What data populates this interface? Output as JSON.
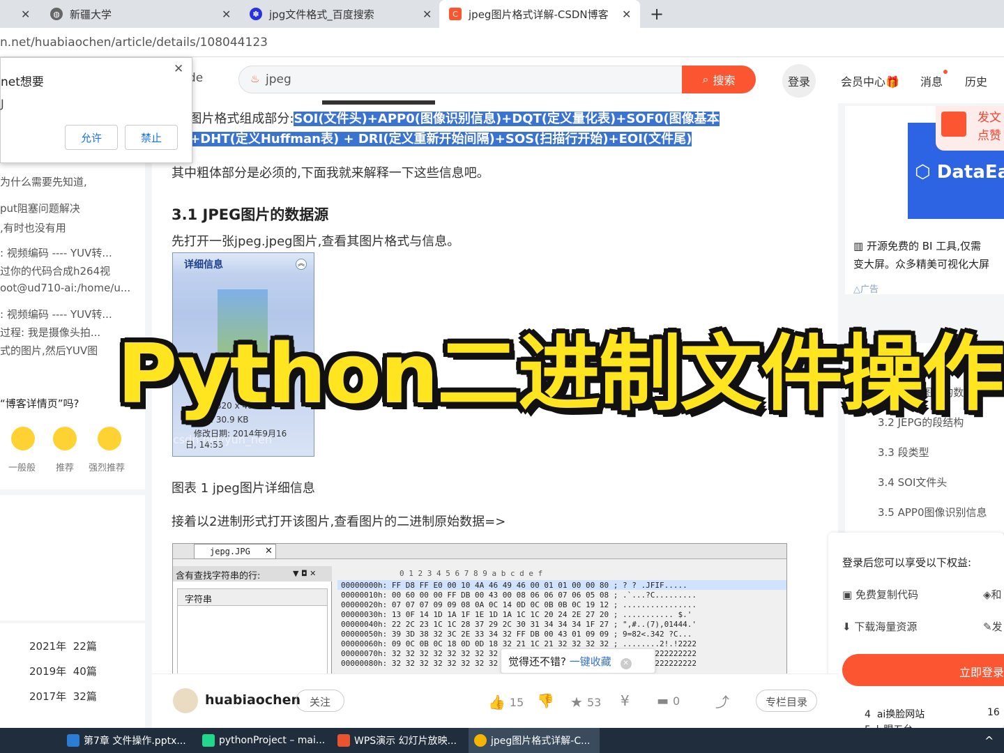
{
  "browser": {
    "tabs": [
      {
        "label": "新疆大学",
        "close": "✕"
      },
      {
        "label": "jpg文件格式_百度搜索",
        "close": "✕"
      },
      {
        "label": "jpeg图片格式详解-CSDN博客",
        "close": "✕"
      }
    ],
    "first_close": "✕",
    "new_tab": "+",
    "url": "n.net/huabiaochen/article/details/108044123"
  },
  "permission_popup": {
    "title": "net想要",
    "line2": "J",
    "allow": "允许",
    "deny": "禁止",
    "close": "✕"
  },
  "nav": {
    "left_fragment": "de",
    "search_value": "jpeg",
    "search_button": "搜索",
    "login": "登录",
    "member": "会员中心",
    "messages": "消息",
    "history": "历史"
  },
  "left": {
    "items": [
      "为什么需要先知道,",
      "put阻塞问题解决",
      ",有时也没有用",
      ":  视频编码 ---- YUV转...",
      "过你的代码合成h264视",
      "oot@ud710-ai:/home/u...",
      ":  视频编码 ---- YUV转...",
      "过程:  我是摄像头拍...",
      "式的图片,然后YUV图"
    ],
    "survey_title": "“博客详情页”吗?",
    "ratings": [
      "一般般",
      "推荐",
      "强烈推荐"
    ],
    "archive": [
      {
        "year": "2021年",
        "count": "22篇"
      },
      {
        "year": "2019年",
        "count": "40篇"
      },
      {
        "year": "2017年",
        "count": "32篇"
      }
    ]
  },
  "article": {
    "intro_prefix": "EG图片格式组成部分:",
    "intro_hl1": "SOI(文件头)+APP0(图像识别信息)+DQT(定义量化表)+SOF0(图像基本",
    "intro_hl2": "息)+DHT(定义Huffman表) + DRI(定义重新开始间隔)+SOS(扫描行开始)+EOI(文件尾)",
    "note": "其中粗体部分是必须的,下面我就来解释一下这些信息吧。",
    "h3": "3.1 JPEG图片的数据源",
    "p1": "先打开一张jpeg.jpeg图片,查看其图片格式与信息。",
    "detail_title": "详细信息",
    "detail_type": "图像",
    "detail_size": "尺寸: 320 x 480",
    "detail_filesize": "大小: 30.9 KB",
    "detail_date": "修改日期: 2014年9月16",
    "detail_time": "日, 14:53",
    "watermark": "csdn.net/yun_hen",
    "caption": "图表 1 jpeg图片详细信息",
    "p2": "接着以2进制形式打开该图片,查看图片的二进制原始数据=>",
    "hex_tab": "jepg.JPG",
    "hex_panel_label": "含有查找字符串的行:",
    "hex_column": "字符串",
    "hex_header": "0  1  2  3  4  5  6  7  8  9  a  b  c  d  e  f",
    "hex_rows": [
      "00000000h: FF D8 FF E0 00 10 4A 46 49 46 00 01 01 00 00 80 ; ?  ? .JFIF.....",
      "00000010h: 00 60 00 00 FF DB 00 43 00 08 06 06 07 06 05 08 ; .`...?C.........",
      "00000020h: 07 07 07 09 09 08 0A 0C 14 0D 0C 0B 0B 0C 19 12 ; ................",
      "00000030h: 13 0F 14 1D 1A 1F 1E 1D 1A 1C 1C 20 24 2E 27 20 ; ........... $.' ",
      "00000040h: 22 2C 23 1C 1C 28 37 29 2C 30 31 34 34 34 1F 27 ; \",#..(7),01444.'",
      "00000050h: 39 3D 38 32 3C 2E 33 34 32 FF DB 00 43 01 09 09 ; 9=82<.342 ?C...",
      "00000060h: 09 0C 0B 0C 18 0D 0D 18 32 21 1C 21 32 32 32 32 ; ........2!.!2222",
      "00000070h: 32 32 32 32 32 32 32 32 32 32 32 32 32 32 32 32 ; 2222222222222222",
      "00000080h: 32 32 32 32 32 32 32 32 32 32 32 32 32 32 32 32 ; 2222222222222222"
    ],
    "tip": "觉得还不错?",
    "tip_action": "一键收藏"
  },
  "overlay_title": "Python二进制文件操作",
  "author_bar": {
    "name": "huabiaochen",
    "follow": "关注",
    "likes": "15",
    "stars": "53",
    "comments": "0",
    "catalog": "专栏目录"
  },
  "sidebar": {
    "ad_brand": "DataEa",
    "ad_badge1": "发文",
    "ad_badge2": "点赞",
    "ad_text1": "开源免费的 BI 工具,仅需",
    "ad_text2": "变大屏。众多精美可视化大屏",
    "ad_label": "广告",
    "toc_title": "G图片格式详解",
    "toc": [
      "3.1 JPEG图片的数据源",
      "3.2 JEPG的段结构",
      "3.3 段类型",
      "3.4 SOI文件头",
      "3.5 APP0图像识别信息"
    ],
    "login_title": "登录后您可以享受以下权益:",
    "benefits": [
      "免费复制代码",
      "下载海量资源"
    ],
    "benefit_r1": "和",
    "benefit_r2": "发",
    "login_button": "立即登录",
    "rank_item": "ai换脸网站",
    "rank_num": "4",
    "rank_count": "16",
    "rank_next": "5  ト眼五台"
  },
  "taskbar": {
    "items": [
      "第7章 文件操作.pptx...",
      "pythonProject – mai...",
      "WPS演示 幻灯片放映...",
      "jpeg图片格式详解-C..."
    ],
    "tray": "^"
  },
  "colors": {
    "accent": "#fc5531",
    "highlight": "#3b73d1",
    "overlay": "#ffe51f",
    "taskbar": "#1f2d3c"
  }
}
